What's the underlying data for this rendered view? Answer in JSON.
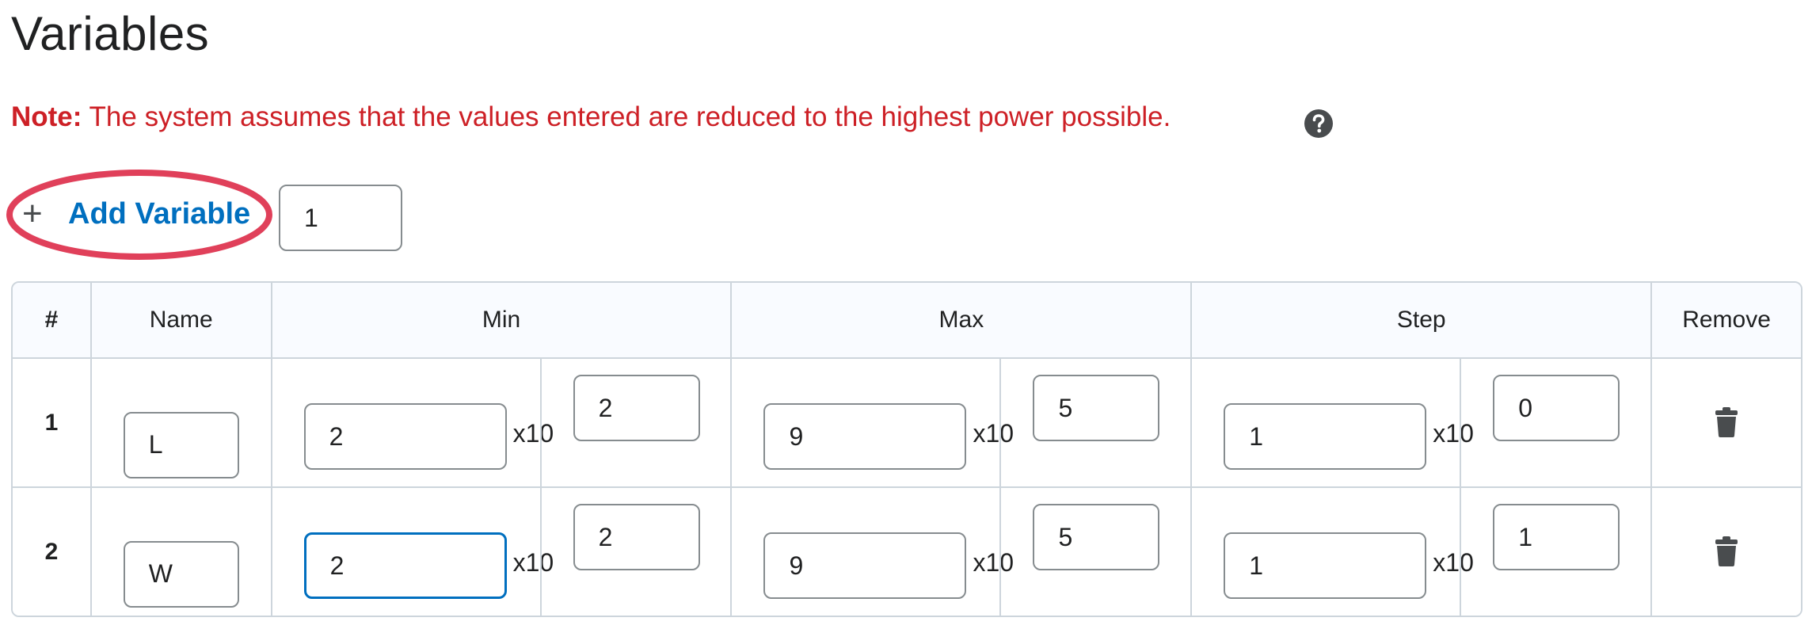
{
  "page": {
    "title": "Variables",
    "note_label": "Note:",
    "note_text": " The system assumes that the values entered are reduced to the highest power possible."
  },
  "icons": {
    "help": "help-circle-icon",
    "add": "plus-icon",
    "remove": "trash-icon"
  },
  "add_variable": {
    "plus": "+",
    "label": "Add Variable",
    "count_value": "1"
  },
  "table": {
    "headers": [
      "#",
      "Name",
      "Min",
      "Max",
      "Step",
      "Remove"
    ],
    "multiplier_label": "x10",
    "rows": [
      {
        "index": "1",
        "name": "L",
        "min": {
          "base": "2",
          "exp": "2"
        },
        "max": {
          "base": "9",
          "exp": "5"
        },
        "step": {
          "base": "1",
          "exp": "0"
        }
      },
      {
        "index": "2",
        "name": "W",
        "min": {
          "base": "2",
          "exp": "2"
        },
        "max": {
          "base": "9",
          "exp": "5"
        },
        "step": {
          "base": "1",
          "exp": "1"
        }
      }
    ]
  },
  "colors": {
    "note": "#cd2026",
    "link": "#006fbf",
    "highlight": "#e0405a",
    "border": "#cdd5dc",
    "header_bg": "#f9fbff"
  }
}
